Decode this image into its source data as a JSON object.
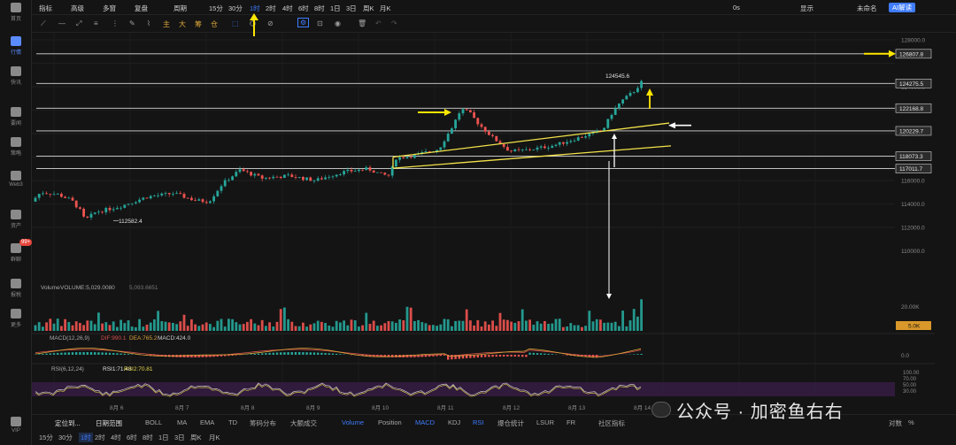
{
  "leftnav": {
    "items": [
      {
        "label": "首页",
        "icon": "home-icon"
      },
      {
        "label": "行情",
        "icon": "market-icon",
        "active": true
      },
      {
        "label": "快讯",
        "icon": "news-icon"
      },
      {
        "label": "要闻",
        "icon": "headline-icon"
      },
      {
        "label": "策略",
        "icon": "strategy-icon"
      },
      {
        "label": "Web3",
        "icon": "web3-icon"
      },
      {
        "label": "资产",
        "icon": "assets-icon"
      },
      {
        "label": "群聊",
        "icon": "chat-icon",
        "badge": "99+"
      },
      {
        "label": "报税",
        "icon": "tax-icon"
      },
      {
        "label": "更多",
        "icon": "more-icon"
      },
      {
        "label": "VIP",
        "icon": "vip-icon"
      }
    ]
  },
  "topbar": {
    "items": [
      "指标",
      "高级",
      "多窗",
      "复盘",
      "周期",
      "15分",
      "30分",
      "1时",
      "2时",
      "4时",
      "6时",
      "8时",
      "1日",
      "3日",
      "周K",
      "月K"
    ],
    "selected": "1时",
    "right": {
      "delay": "0s",
      "show": "显示",
      "name": "未命名",
      "ai": "AI解读"
    }
  },
  "toolrow": {
    "labels": [
      "主",
      "大",
      "筹",
      "仓"
    ]
  },
  "price_axis": {
    "ticks": [
      "128000.0",
      "124000.0",
      "122000.0",
      "120000.0",
      "118000.0",
      "116000.0",
      "114000.0",
      "112000.0",
      "110000.0"
    ],
    "levels": [
      "126807.8",
      "124275.5",
      "122168.8",
      "120229.7",
      "118073.3",
      "117011.7"
    ]
  },
  "annotations": {
    "high": "124545.6",
    "low": "112582.4"
  },
  "volume": {
    "label": "Volume",
    "text": "VOLUME:5,029.0080",
    "ma": "5,093.6651",
    "axis": "20.00K",
    "current": "5.0K"
  },
  "macd": {
    "label": "MACD(12,26,9)",
    "dif": "DIF:990.1",
    "dea": "DEA:765.2",
    "macd": "MACD:424.0",
    "axis": "0.0"
  },
  "rsi": {
    "label": "RSI(6,12,24)",
    "rsi1": "RSI1:71.48",
    "rsi2": "RSI2:70.81",
    "axis": [
      "100.00",
      "70.00",
      "50.00",
      "30.00"
    ]
  },
  "dates": [
    "8月 6",
    "8月 7",
    "8月 8",
    "8月 9",
    "8月 10",
    "8月 11",
    "8月 12",
    "8月 13",
    "8月 14"
  ],
  "botbar1": {
    "items": [
      "定位到...",
      "日期范围",
      "BOLL",
      "MA",
      "EMA",
      "TD",
      "筹码分布",
      "大额成交",
      "Volume",
      "Position",
      "MACD",
      "KDJ",
      "RSI",
      "爆仓统计",
      "LSUR",
      "FR",
      "社区指标"
    ],
    "selected": [
      "Volume",
      "MACD",
      "RSI"
    ],
    "right": [
      "对数",
      "%"
    ]
  },
  "botbar2": {
    "items": [
      "15分",
      "30分",
      "1时",
      "2时",
      "4时",
      "6时",
      "8时",
      "1日",
      "3日",
      "周K",
      "月K"
    ],
    "selected": "1时"
  },
  "watermark": "公众号 · 加密鱼右右",
  "colors": {
    "up": "#26a69a",
    "down": "#ef5350",
    "accent": "#3f7cff",
    "trend": "#f2e24a",
    "arrow_yellow": "#ffe600"
  }
}
